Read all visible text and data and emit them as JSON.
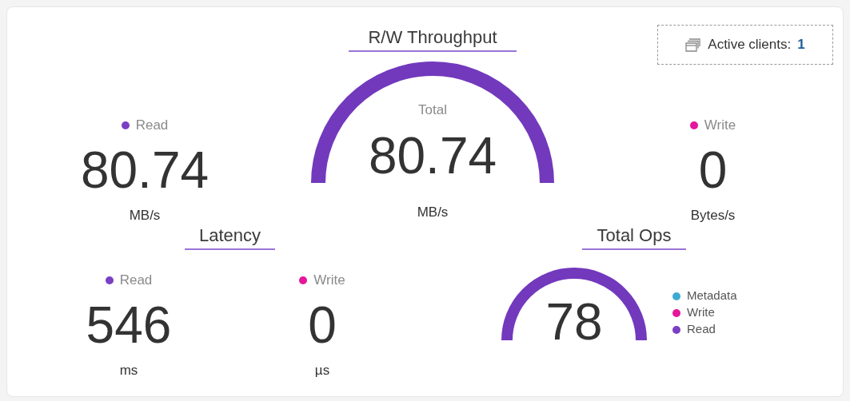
{
  "active_clients": {
    "label": "Active clients:",
    "value": "1"
  },
  "throughput": {
    "title": "R/W Throughput",
    "read": {
      "label": "Read",
      "color": "#7b3fc4",
      "value": "80.74",
      "unit": "MB/s"
    },
    "total": {
      "label": "Total",
      "value": "80.74",
      "unit": "MB/s"
    },
    "write": {
      "label": "Write",
      "color": "#e5169b",
      "value": "0",
      "unit": "Bytes/s"
    }
  },
  "latency": {
    "title": "Latency",
    "items": [
      {
        "label": "Read",
        "color": "#7b3fc4",
        "value": "546",
        "unit": "ms"
      },
      {
        "label": "Write",
        "color": "#e5169b",
        "value": "0",
        "unit": "µs"
      }
    ]
  },
  "total_ops": {
    "title": "Total Ops",
    "value": "78",
    "legend": [
      {
        "label": "Metadata",
        "color": "#3da9d4"
      },
      {
        "label": "Write",
        "color": "#e5169b"
      },
      {
        "label": "Read",
        "color": "#7b3fc4"
      }
    ]
  }
}
